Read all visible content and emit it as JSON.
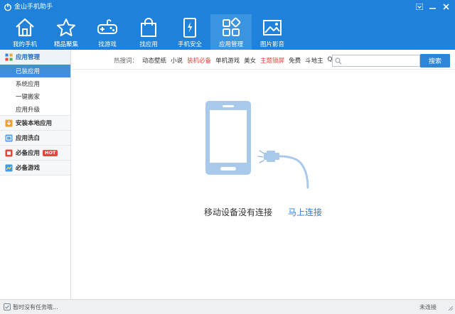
{
  "app": {
    "title": "金山手机助手"
  },
  "toolbar": {
    "items": [
      {
        "label": "我的手机",
        "icon": "home-icon"
      },
      {
        "label": "精品聚集",
        "icon": "star-icon"
      },
      {
        "label": "找游戏",
        "icon": "gamepad-icon"
      },
      {
        "label": "找应用",
        "icon": "bag-icon"
      },
      {
        "label": "手机安全",
        "icon": "phone-shield-icon"
      },
      {
        "label": "应用管理",
        "icon": "apps-grid-icon"
      },
      {
        "label": "图片影音",
        "icon": "picture-icon"
      }
    ],
    "active": "应用管理"
  },
  "sidebar": {
    "groups": [
      {
        "label": "应用管理",
        "icon": "apps-icon",
        "items": [
          "已装应用",
          "系统应用",
          "一键搬家",
          "应用升级"
        ],
        "active_item": "已装应用"
      },
      {
        "label": "安装本地应用",
        "icon": "install-icon"
      },
      {
        "label": "应用洗白",
        "icon": "wash-icon"
      },
      {
        "label": "必备应用",
        "icon": "must-apps-icon",
        "badge": "HOT"
      },
      {
        "label": "必备游戏",
        "icon": "must-games-icon"
      }
    ]
  },
  "search": {
    "hot_label": "热搜词：",
    "hot_words": [
      {
        "text": "动态壁纸",
        "red": false
      },
      {
        "text": "小说",
        "red": false
      },
      {
        "text": "装机必备",
        "red": true
      },
      {
        "text": "单机游戏",
        "red": false
      },
      {
        "text": "美女",
        "red": false
      },
      {
        "text": "主题锁屏",
        "red": true
      },
      {
        "text": "免费",
        "red": false
      },
      {
        "text": "斗地主",
        "red": false
      },
      {
        "text": "QQ",
        "red": false
      }
    ],
    "placeholder": "",
    "button_label": "搜索"
  },
  "main": {
    "empty_message": "移动设备没有连接",
    "connect_link": "马上连接"
  },
  "status": {
    "left_text": "暂时没有任务哦...",
    "right_text": "未连接"
  },
  "colors": {
    "brand": "#1f81d9",
    "active_tab": "#3a94e0",
    "active_item": "#3f8fda",
    "hot_red": "#e8443a",
    "link": "#2a7ed4",
    "illustration": "#a9c9ea"
  }
}
